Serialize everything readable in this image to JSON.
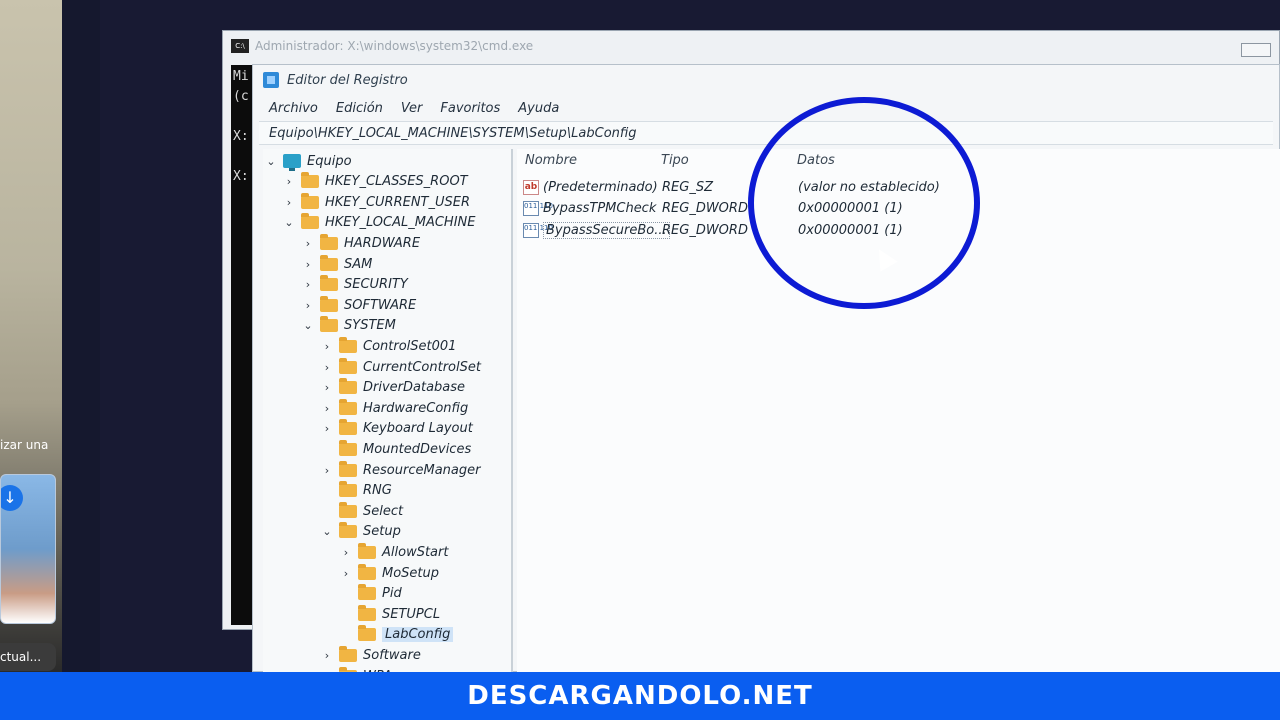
{
  "side": {
    "text_fragment": "izar una",
    "caption_fragment": "ctual..."
  },
  "cmd_window": {
    "title": "Administrador: X:\\windows\\system32\\cmd.exe",
    "lines": [
      "Mi",
      "(c",
      "",
      "X:",
      "",
      "X:"
    ]
  },
  "regedit": {
    "title": "Editor del Registro",
    "menu": [
      "Archivo",
      "Edición",
      "Ver",
      "Favoritos",
      "Ayuda"
    ],
    "address": "Equipo\\HKEY_LOCAL_MACHINE\\SYSTEM\\Setup\\LabConfig",
    "tree": [
      {
        "label": "Equipo",
        "icon": "computer-icon",
        "chevron": "down"
      },
      {
        "label": "HKEY_CLASSES_ROOT",
        "icon": "folder-icon",
        "chevron": "right"
      },
      {
        "label": "HKEY_CURRENT_USER",
        "icon": "folder-icon",
        "chevron": "right"
      },
      {
        "label": "HKEY_LOCAL_MACHINE",
        "icon": "folder-icon",
        "chevron": "down"
      },
      {
        "label": "HARDWARE",
        "icon": "folder-icon",
        "chevron": "right"
      },
      {
        "label": "SAM",
        "icon": "folder-icon",
        "chevron": "right"
      },
      {
        "label": "SECURITY",
        "icon": "folder-icon",
        "chevron": "right"
      },
      {
        "label": "SOFTWARE",
        "icon": "folder-icon",
        "chevron": "right"
      },
      {
        "label": "SYSTEM",
        "icon": "folder-icon",
        "chevron": "down"
      },
      {
        "label": "ControlSet001",
        "icon": "folder-icon",
        "chevron": "right"
      },
      {
        "label": "CurrentControlSet",
        "icon": "folder-icon",
        "chevron": "right"
      },
      {
        "label": "DriverDatabase",
        "icon": "folder-icon",
        "chevron": "right"
      },
      {
        "label": "HardwareConfig",
        "icon": "folder-icon",
        "chevron": "right"
      },
      {
        "label": "Keyboard Layout",
        "icon": "folder-icon",
        "chevron": "right"
      },
      {
        "label": "MountedDevices",
        "icon": "folder-icon",
        "chevron": ""
      },
      {
        "label": "ResourceManager",
        "icon": "folder-icon",
        "chevron": "right"
      },
      {
        "label": "RNG",
        "icon": "folder-icon",
        "chevron": ""
      },
      {
        "label": "Select",
        "icon": "folder-icon",
        "chevron": ""
      },
      {
        "label": "Setup",
        "icon": "folder-icon",
        "chevron": "down"
      },
      {
        "label": "AllowStart",
        "icon": "folder-icon",
        "chevron": "right"
      },
      {
        "label": "MoSetup",
        "icon": "folder-icon",
        "chevron": "right"
      },
      {
        "label": "Pid",
        "icon": "folder-icon",
        "chevron": ""
      },
      {
        "label": "SETUPCL",
        "icon": "folder-icon",
        "chevron": ""
      },
      {
        "label": "LabConfig",
        "icon": "folder-icon",
        "chevron": "",
        "selected": true
      },
      {
        "label": "Software",
        "icon": "folder-icon",
        "chevron": "right"
      },
      {
        "label": "WPA",
        "icon": "folder-icon",
        "chevron": ""
      }
    ],
    "columns": [
      "Nombre",
      "Tipo",
      "Datos"
    ],
    "values": [
      {
        "name": "(Predeterminado)",
        "type": "REG_SZ",
        "data": "(valor no establecido)",
        "icon": "string-value-icon"
      },
      {
        "name": "BypassTPMCheck",
        "type": "REG_DWORD",
        "data": "0x00000001 (1)",
        "icon": "binary-value-icon"
      },
      {
        "name": "BypassSecureBo...",
        "type": "REG_DWORD",
        "data": "0x00000001 (1)",
        "icon": "binary-value-icon"
      }
    ]
  },
  "annotation": {
    "circle_color": "#0d1bd4"
  },
  "banner": {
    "text": "DESCARGANDOLO.NET",
    "color": "#0a5ef0"
  }
}
